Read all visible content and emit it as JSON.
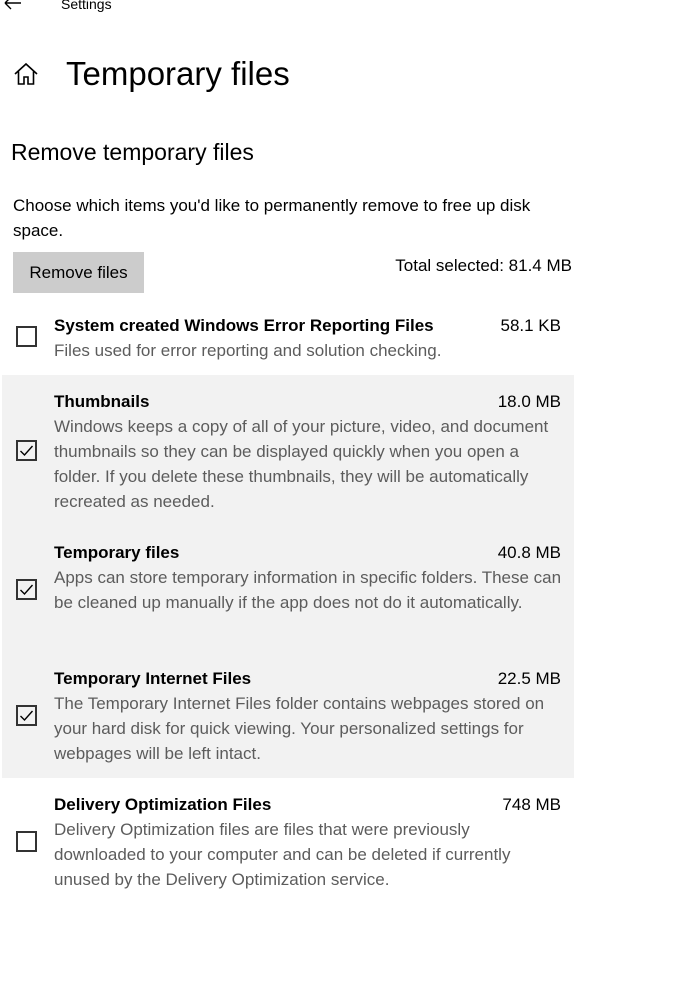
{
  "window": {
    "app_title": "Settings",
    "back_icon": "back-arrow-icon"
  },
  "header": {
    "home_icon": "home-icon",
    "page_title": "Temporary files"
  },
  "section": {
    "title": "Remove temporary files",
    "description": "Choose which items you'd like to permanently remove to free up disk space.",
    "remove_button_label": "Remove files",
    "total_selected": "Total selected: 81.4 MB"
  },
  "items": [
    {
      "name": "System created Windows Error Reporting Files",
      "size": "58.1 KB",
      "description": "Files used for error reporting and solution checking.",
      "checked": false
    },
    {
      "name": "Thumbnails",
      "size": "18.0 MB",
      "description": "Windows keeps a copy of all of your picture, video, and document thumbnails so they can be displayed quickly when you open a folder. If you delete these thumbnails, they will be automatically recreated as needed.",
      "checked": true
    },
    {
      "name": "Temporary files",
      "size": "40.8 MB",
      "description": "Apps can store temporary information in specific folders. These can be cleaned up manually if the app does not do it automatically.",
      "checked": true
    },
    {
      "name": "Temporary Internet Files",
      "size": "22.5 MB",
      "description": "The Temporary Internet Files folder contains webpages stored on your hard disk for quick viewing. Your personalized settings for webpages will be left intact.",
      "checked": true
    },
    {
      "name": "Delivery Optimization Files",
      "size": "748 MB",
      "description": "Delivery Optimization files are files that were previously downloaded to your computer and can be deleted if currently unused by the Delivery Optimization service.",
      "checked": false
    }
  ],
  "colors": {
    "selected_row_background": "#f2f2f2",
    "button_background": "#cccccc",
    "secondary_text": "#5c5c5c"
  }
}
